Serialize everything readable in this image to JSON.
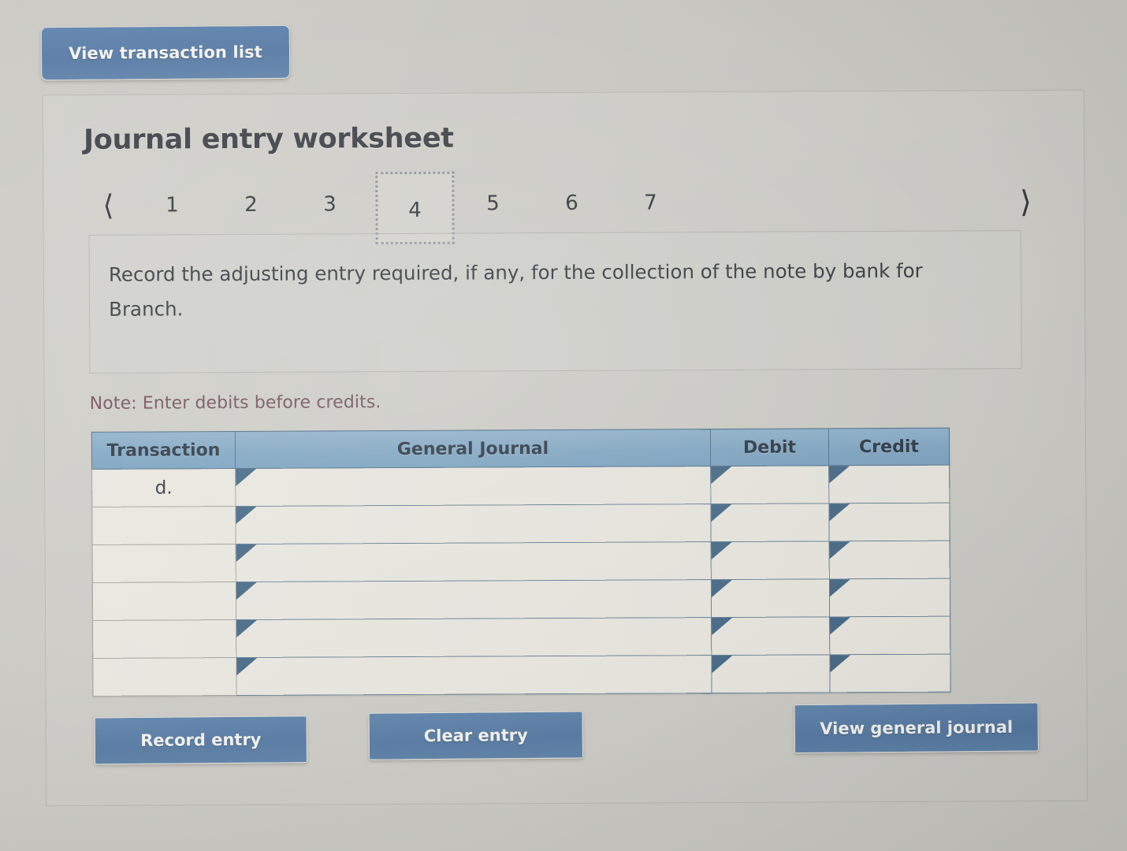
{
  "toolbar": {
    "view_transaction_list_label": "View transaction list"
  },
  "worksheet": {
    "title": "Journal entry worksheet",
    "pager": {
      "prev_icon": "chevron-left-icon",
      "next_icon": "chevron-right-icon",
      "pages": [
        "1",
        "2",
        "3",
        "4",
        "5",
        "6",
        "7"
      ],
      "active_page": "4"
    },
    "instruction": "Record the adjusting entry required, if any, for the collection of the note by bank for Branch.",
    "note": "Note: Enter debits before credits.",
    "table": {
      "headers": [
        "Transaction",
        "General Journal",
        "Debit",
        "Credit"
      ],
      "rows": [
        {
          "transaction": "d.",
          "general_journal": "",
          "debit": "",
          "credit": ""
        },
        {
          "transaction": "",
          "general_journal": "",
          "debit": "",
          "credit": ""
        },
        {
          "transaction": "",
          "general_journal": "",
          "debit": "",
          "credit": ""
        },
        {
          "transaction": "",
          "general_journal": "",
          "debit": "",
          "credit": ""
        },
        {
          "transaction": "",
          "general_journal": "",
          "debit": "",
          "credit": ""
        },
        {
          "transaction": "",
          "general_journal": "",
          "debit": "",
          "credit": ""
        }
      ],
      "row_marker_icon": "triangle-right-icon"
    },
    "actions": {
      "record_entry_label": "Record entry",
      "clear_entry_label": "Clear entry",
      "view_general_journal_label": "View general journal"
    }
  },
  "colors": {
    "page_background": "#c9c8c2",
    "button_blue": "#50759f",
    "header_blue": "#7da4c2",
    "cell_background": "#e9e7df",
    "note_maroon": "#6e4b52",
    "text_dark": "#2e3238"
  }
}
